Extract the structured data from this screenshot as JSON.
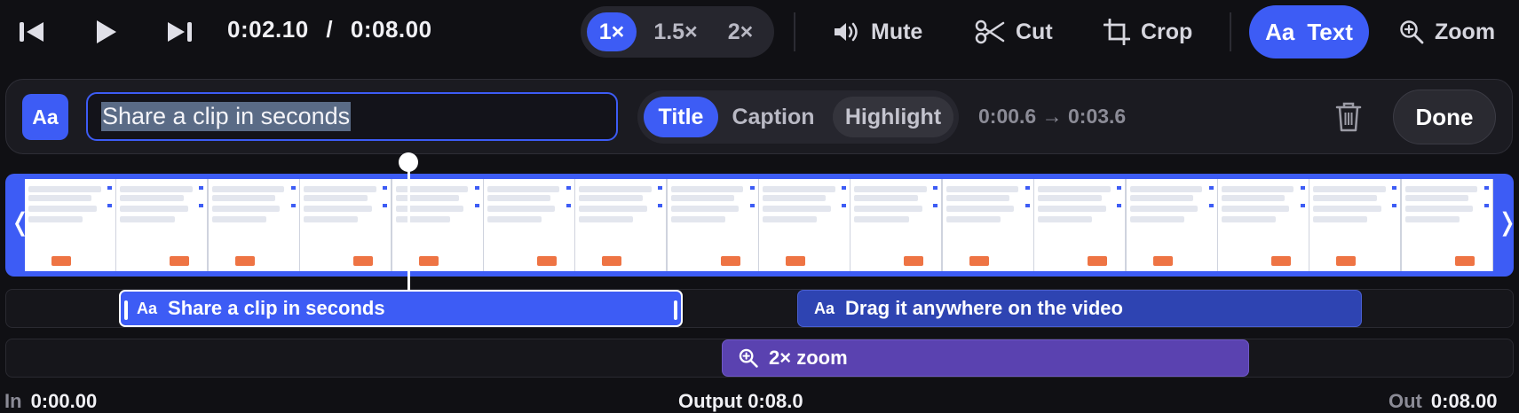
{
  "toolbar": {
    "current_time": "0:02.10",
    "separator": "/",
    "total_time": "0:08.00",
    "speeds": [
      "1×",
      "1.5×",
      "2×"
    ],
    "active_speed": "1×",
    "mute_label": "Mute",
    "cut_label": "Cut",
    "crop_label": "Crop",
    "text_icon": "Aa",
    "text_label": "Text",
    "zoom_label": "Zoom",
    "icons": {
      "skip_back": "skip-back-icon",
      "play": "play-icon",
      "skip_forward": "skip-forward-icon",
      "mute": "speaker-icon",
      "cut": "scissors-icon",
      "crop": "crop-icon",
      "zoom": "zoom-in-icon"
    }
  },
  "text_editor": {
    "badge": "Aa",
    "value": "Share a clip in seconds",
    "styles": [
      "Title",
      "Caption",
      "Highlight"
    ],
    "active_style": "Title",
    "range": "0:00.6 → 0:03.6",
    "delete_icon": "trash-icon",
    "done_label": "Done"
  },
  "timeline": {
    "left_handle": "❬",
    "right_handle": "❭",
    "text_clips": [
      {
        "icon": "Aa",
        "label": "Share a clip in seconds"
      },
      {
        "icon": "Aa",
        "label": "Drag it anywhere on the video"
      }
    ],
    "zoom_clip": {
      "label": "2× zoom",
      "icon": "zoom-in-icon"
    },
    "playhead_time": "0:02.10"
  },
  "footer": {
    "in_label": "In",
    "in_time": "0:00.00",
    "output_label": "Output 0:08.0",
    "out_label": "Out",
    "out_time": "0:08.00"
  },
  "colors": {
    "accent": "#3d5cf5",
    "background": "#101014",
    "zoom_clip": "#5a42b0",
    "secondary_clip": "#2e44b2"
  }
}
